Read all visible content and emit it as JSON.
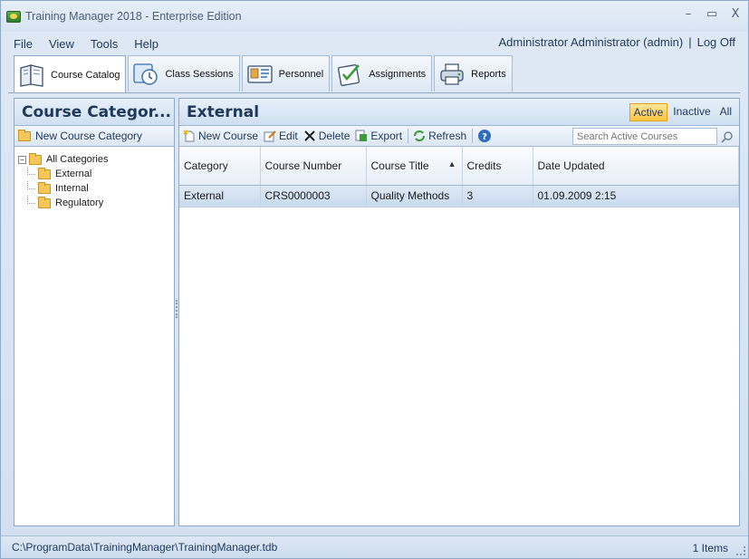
{
  "window": {
    "title": "Training Manager 2018 - Enterprise Edition",
    "controls": {
      "minimize": "–",
      "maximize": "▭",
      "close": "X"
    }
  },
  "menu": {
    "items": [
      "File",
      "View",
      "Tools",
      "Help"
    ],
    "user": "Administrator Administrator (admin)",
    "separator": "|",
    "logoff": "Log Off"
  },
  "tabs": [
    {
      "label": "Course Catalog",
      "icon": "book-icon",
      "active": true
    },
    {
      "label": "Class Sessions",
      "icon": "clock-icon",
      "active": false
    },
    {
      "label": "Personnel",
      "icon": "id-card-icon",
      "active": false
    },
    {
      "label": "Assignments",
      "icon": "checklist-icon",
      "active": false
    },
    {
      "label": "Reports",
      "icon": "printer-icon",
      "active": false
    }
  ],
  "left_panel": {
    "title": "Course Categor...",
    "new_category": "New Course Category",
    "tree": {
      "root": "All Categories",
      "children": [
        "External",
        "Internal",
        "Regulatory"
      ]
    }
  },
  "right_panel": {
    "title": "External",
    "filters": [
      "Active",
      "Inactive",
      "All"
    ],
    "toolbar": {
      "new_course": "New Course",
      "edit": "Edit",
      "delete": "Delete",
      "export": "Export",
      "refresh": "Refresh",
      "search_placeholder": "Search Active Courses"
    },
    "columns": [
      "Category",
      "Course Number",
      "Course Title",
      "Credits",
      "Date Updated"
    ],
    "rows": [
      [
        "External",
        "CRS0000003",
        "Quality Methods",
        "3",
        "01.09.2009 2:15"
      ]
    ]
  },
  "status": {
    "path": "C:\\ProgramData\\TrainingManager\\TrainingManager.tdb",
    "count": "1 Items"
  },
  "colors": {
    "accent": "#1e395b",
    "active_filter": "#ffc43d",
    "selected_row": "#c8d9ee"
  }
}
